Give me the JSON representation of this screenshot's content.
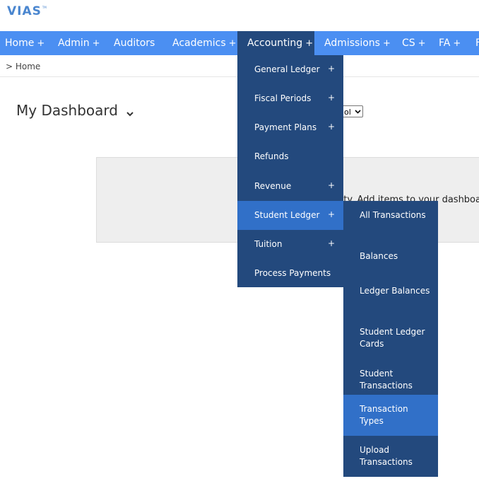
{
  "logo": {
    "text": "VIAS",
    "tm": "TM"
  },
  "topnav": {
    "items": [
      {
        "label": "Home",
        "plus": "+"
      },
      {
        "label": "Admin",
        "plus": "+"
      },
      {
        "label": "Auditors",
        "plus": ""
      },
      {
        "label": "Academics",
        "plus": "+"
      },
      {
        "label": "Accounting",
        "plus": "+"
      },
      {
        "label": "Admissions",
        "plus": "+"
      },
      {
        "label": "CS",
        "plus": "+"
      },
      {
        "label": "FA",
        "plus": "+"
      },
      {
        "label": "F",
        "plus": ""
      }
    ]
  },
  "breadcrumb": "> Home",
  "dashboard": {
    "title": "My Dashboard",
    "select_value": "ol",
    "empty_message": "pty. Add items to your dashboard"
  },
  "accounting_menu": {
    "items": [
      {
        "label": "General Ledger",
        "plus": "+"
      },
      {
        "label": "Fiscal Periods",
        "plus": "+"
      },
      {
        "label": "Payment Plans",
        "plus": "+"
      },
      {
        "label": "Refunds",
        "plus": ""
      },
      {
        "label": "Revenue",
        "plus": "+"
      },
      {
        "label": "Student Ledger",
        "plus": "+"
      },
      {
        "label": "Tuition",
        "plus": "+"
      },
      {
        "label": "Process Payments",
        "plus": ""
      }
    ],
    "active_index": 5
  },
  "student_ledger_menu": {
    "items": [
      {
        "label": "All Transactions"
      },
      {
        "label": "Balances"
      },
      {
        "label": "Ledger Balances"
      },
      {
        "label": "Student Ledger Cards"
      },
      {
        "label": "Student Transactions"
      },
      {
        "label": "Transaction Types"
      },
      {
        "label": "Upload Transactions"
      }
    ],
    "active_index": 5
  },
  "colors": {
    "nav_bg": "#4b8ff2",
    "menu_bg": "#23497d",
    "menu_active": "#3170c8",
    "logo": "#4a86cf"
  },
  "icons": {
    "dashboard_toggle": "chevron-down-icon"
  }
}
